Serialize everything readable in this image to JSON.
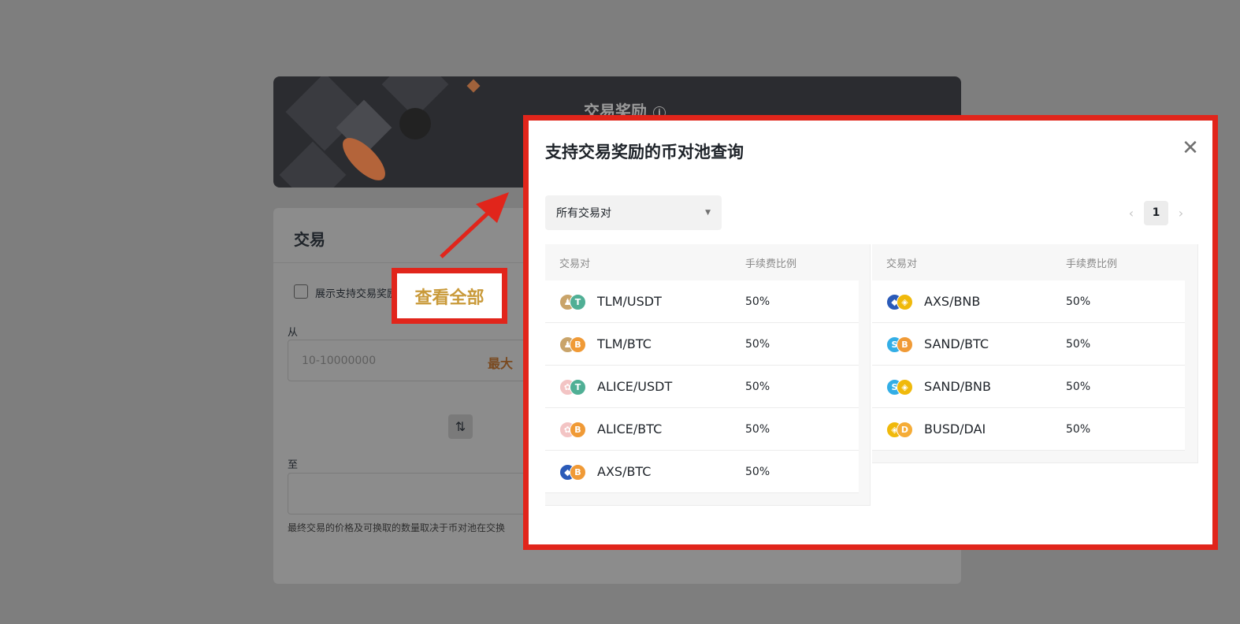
{
  "background": {
    "banner_title": "交易奖励",
    "banner_info_icon": "i",
    "card_title": "交易",
    "checkbox_label": "展示支持交易奖励",
    "from_label": "从",
    "from_placeholder": "10-10000000",
    "max_label": "最大",
    "swap_icon": "⇅",
    "to_label": "至",
    "note": "最终交易的价格及可换取的数量取决于币对池在交换"
  },
  "callout": {
    "label": "查看全部"
  },
  "modal": {
    "title": "支持交易奖励的币对池查询",
    "close_icon": "✕",
    "dropdown": {
      "selected": "所有交易对",
      "caret": "▼"
    },
    "pagination": {
      "prev": "‹",
      "current": "1",
      "next": "›"
    },
    "headers": {
      "pair": "交易对",
      "fee": "手续费比例"
    },
    "left_rows": [
      {
        "pair": "TLM/USDT",
        "fee": "50%",
        "icon_a": "tlm-icon",
        "icon_b": "usdt-icon"
      },
      {
        "pair": "TLM/BTC",
        "fee": "50%",
        "icon_a": "tlm-icon",
        "icon_b": "btc-icon"
      },
      {
        "pair": "ALICE/USDT",
        "fee": "50%",
        "icon_a": "alice-icon",
        "icon_b": "usdt-icon"
      },
      {
        "pair": "ALICE/BTC",
        "fee": "50%",
        "icon_a": "alice-icon",
        "icon_b": "btc-icon"
      },
      {
        "pair": "AXS/BTC",
        "fee": "50%",
        "icon_a": "axs-icon",
        "icon_b": "btc-icon"
      }
    ],
    "right_rows": [
      {
        "pair": "AXS/BNB",
        "fee": "50%",
        "icon_a": "axs-icon",
        "icon_b": "bnb-icon"
      },
      {
        "pair": "SAND/BTC",
        "fee": "50%",
        "icon_a": "sand-icon",
        "icon_b": "btc-icon"
      },
      {
        "pair": "SAND/BNB",
        "fee": "50%",
        "icon_a": "sand-icon",
        "icon_b": "bnb-icon"
      },
      {
        "pair": "BUSD/DAI",
        "fee": "50%",
        "icon_a": "busd-icon",
        "icon_b": "dai-icon"
      }
    ]
  },
  "coin_styles": {
    "tlm-icon": {
      "color": "#c9a46a",
      "glyph": "♟"
    },
    "usdt-icon": {
      "color": "#50af95",
      "glyph": "T"
    },
    "btc-icon": {
      "color": "#f09a36",
      "glyph": "B"
    },
    "alice-icon": {
      "color": "#f3c4c4",
      "glyph": "✿"
    },
    "axs-icon": {
      "color": "#2a5ab8",
      "glyph": "◆"
    },
    "bnb-icon": {
      "color": "#f0b90b",
      "glyph": "◈"
    },
    "sand-icon": {
      "color": "#33aee6",
      "glyph": "S"
    },
    "busd-icon": {
      "color": "#f0b90b",
      "glyph": "◈"
    },
    "dai-icon": {
      "color": "#f5ac37",
      "glyph": "D"
    }
  },
  "colors": {
    "highlight": "#e1251b",
    "callout_text": "#c99a3a"
  }
}
